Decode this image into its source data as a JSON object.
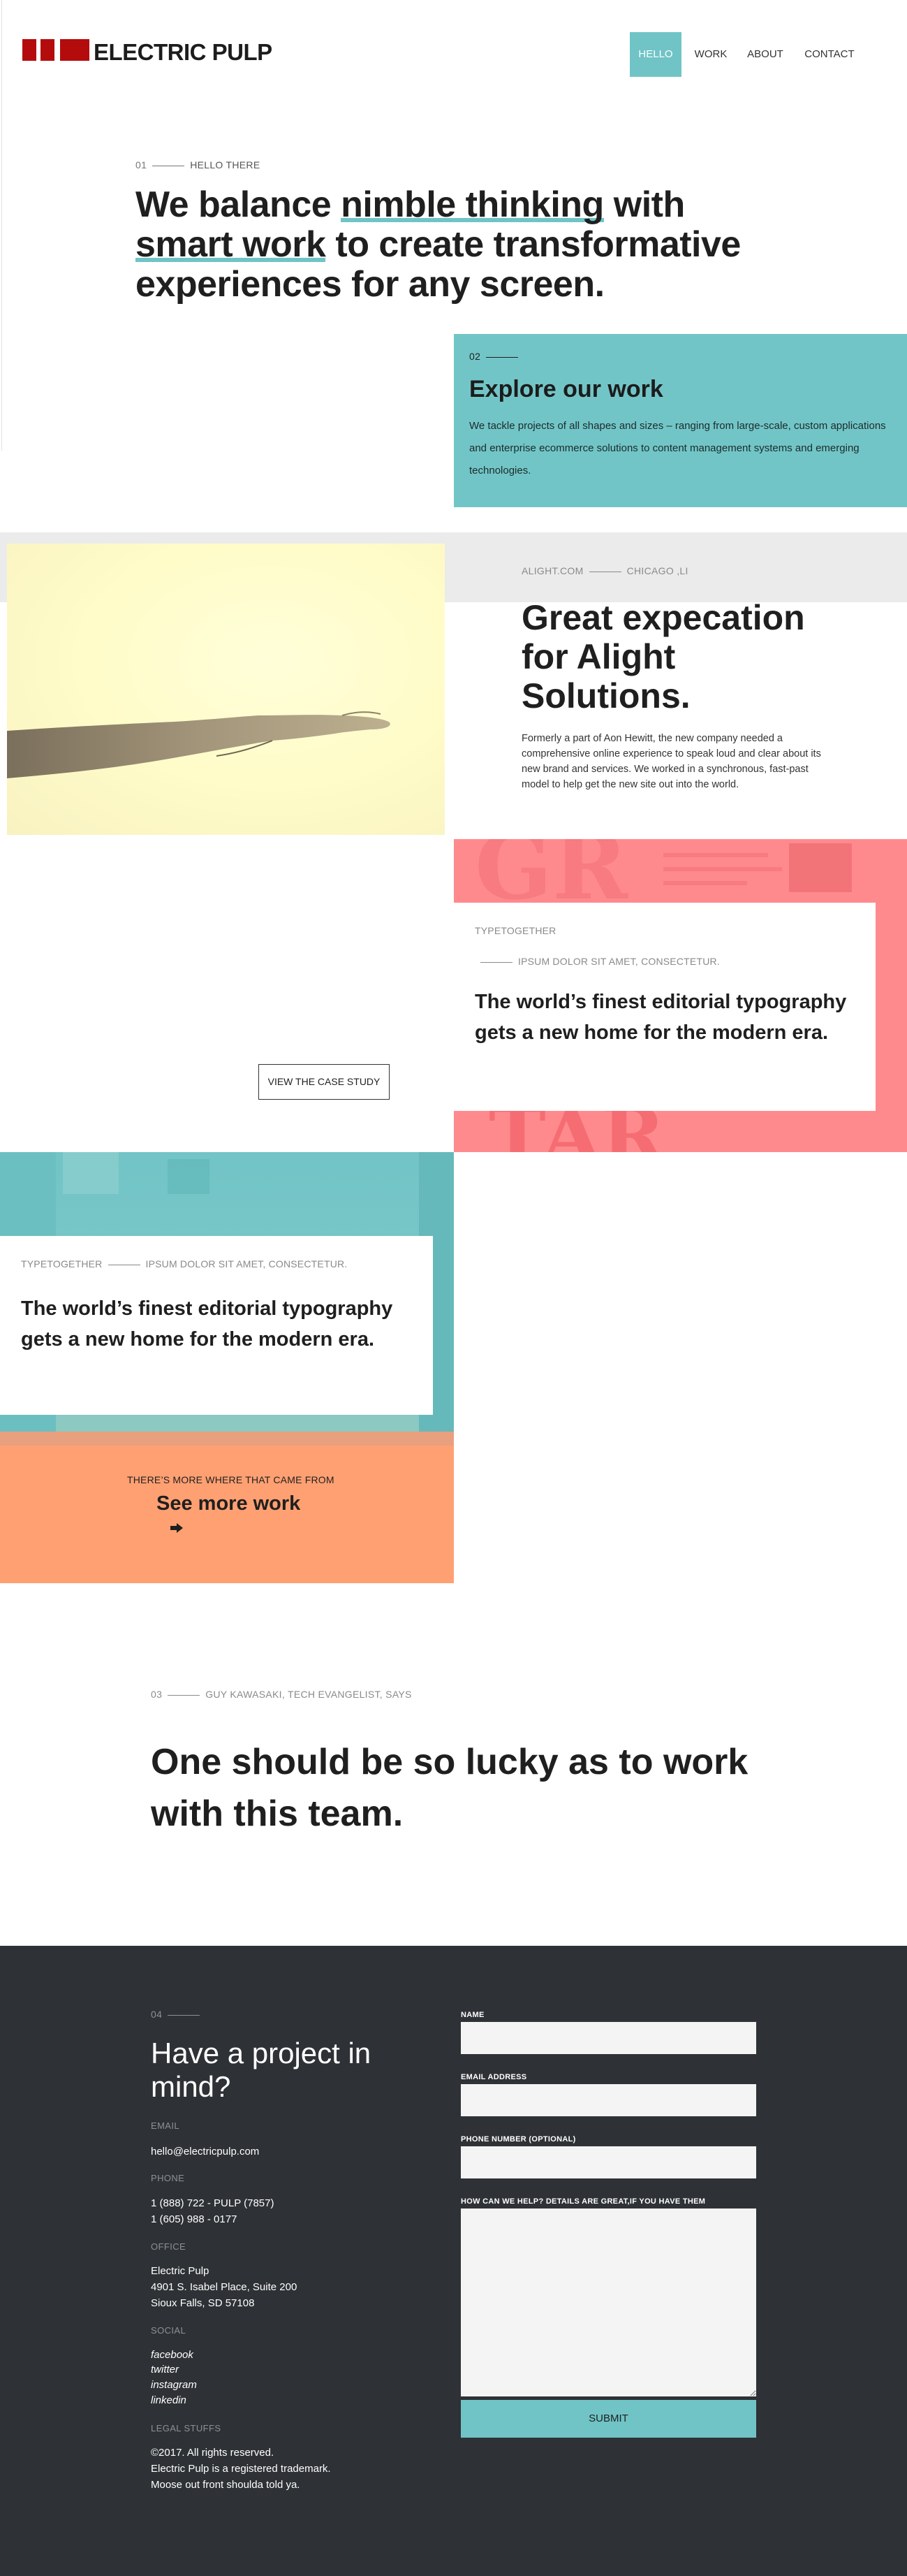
{
  "brand": {
    "name": "ELECTRIC PULP",
    "logo_color": "#b40c0c",
    "accent": "#70c4c6"
  },
  "nav": {
    "items": [
      "HELLO",
      "WORK",
      "ABOUT",
      "CONTACT"
    ],
    "active": "HELLO"
  },
  "hero": {
    "num": "01",
    "eyebrow": "HELLO THERE",
    "headline_parts": [
      "We balance ",
      "nimble thinking",
      " with ",
      "smart work",
      " to create transformative experiences for any screen."
    ]
  },
  "explore": {
    "num": "02",
    "title": "Explore our work",
    "body": "We tackle projects of all shapes and sizes – ranging from large-scale, custom applications and enterprise ecommerce solutions to content management systems and emerging technologies."
  },
  "alight": {
    "site": "ALIGHT.COM",
    "location": "CHICAGO ,LI",
    "title": "Great expecation for Alight Solutions.",
    "body": "Formerly a part of Aon Hewitt, the new company needed a comprehensive online experience to speak loud and clear about its new brand and services. We worked in a synchronous, fast-past model to help get the new site out into the world."
  },
  "case_red": {
    "client": "TYPETOGETHER",
    "tagline": "IPSUM DOLOR SIT AMET, CONSECTETUR.",
    "title": "The world’s finest editorial typography gets a new home for the modern era.",
    "button": "VIEW THE CASE STUDY",
    "bg_color": "#ff8a8e"
  },
  "case_teal": {
    "client": "TYPETOGETHER",
    "tagline": "IPSUM DOLOR SIT AMET, CONSECTETUR.",
    "title": "The world’s finest editorial typography gets a new home for the modern era."
  },
  "more_work": {
    "eyebrow": "THERE’S MORE WHERE THAT CAME FROM",
    "title": "See more work",
    "icon": "arrow-right-icon",
    "bg_color": "#ffa072"
  },
  "quote": {
    "num": "03",
    "attribution": "GUY KAWASAKI, TECH EVANGELIST, SAYS",
    "text": "One should be so lucky as to work with this team."
  },
  "contact": {
    "num": "04",
    "title": "Have a project in mind?",
    "email_label": "EMAIL",
    "email": "hello@electricpulp.com",
    "phone_label": "PHONE",
    "phones": [
      "1 (888) 722 - PULP (7857)",
      "1 (605) 988 - 0177"
    ],
    "office_label": "OFFICE",
    "office": [
      "Electric Pulp",
      "4901 S. Isabel Place, Suite 200",
      "Sioux Falls, SD 57108"
    ],
    "social_label": "SOCIAL",
    "social": [
      "facebook",
      "twitter",
      "instagram",
      "linkedin"
    ],
    "legal_label": "LEGAL STUFFS",
    "legal": [
      "©2017. All rights reserved.",
      "Electric Pulp is a registered trademark.",
      "Moose out front shoulda told ya."
    ],
    "form": {
      "name_label": "NAME",
      "email_label": "EMAIL ADDRESS",
      "phone_label": "PHONE NUMBER (OPTIONAL)",
      "message_label": "HOW CAN WE HELP? DETAILS ARE GREAT,IF YOU HAVE THEM",
      "submit": "SUBMIT"
    }
  }
}
